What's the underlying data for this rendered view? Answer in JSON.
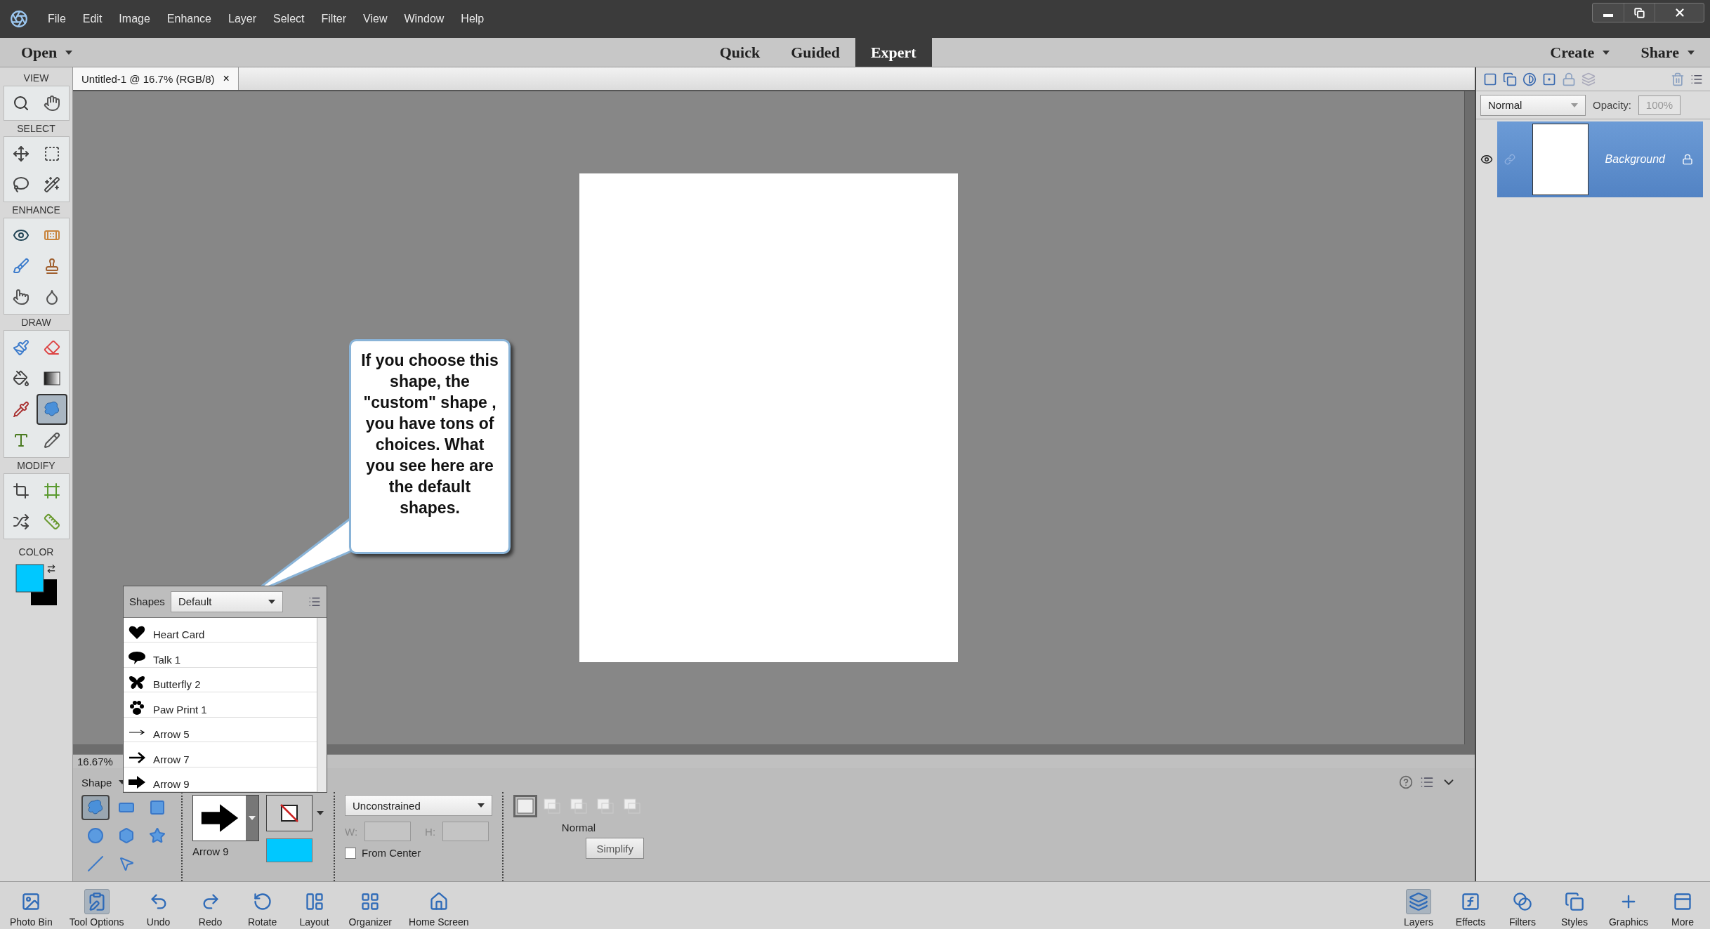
{
  "menu_bar": {
    "items": [
      "File",
      "Edit",
      "Image",
      "Enhance",
      "Layer",
      "Select",
      "Filter",
      "View",
      "Window",
      "Help"
    ]
  },
  "mode_bar": {
    "open": "Open",
    "modes": [
      {
        "label": "Quick",
        "selected": false
      },
      {
        "label": "Guided",
        "selected": false
      },
      {
        "label": "Expert",
        "selected": true
      }
    ],
    "create": "Create",
    "share": "Share"
  },
  "toolbox": {
    "groups": [
      {
        "label": "VIEW",
        "tools": [
          {
            "selected": false
          },
          {
            "selected": false
          }
        ]
      },
      {
        "label": "SELECT",
        "tools": [
          {
            "selected": false
          },
          {
            "selected": false
          },
          {
            "selected": false
          },
          {
            "selected": false
          }
        ]
      },
      {
        "label": "ENHANCE",
        "tools": [
          {
            "selected": false
          },
          {
            "selected": false
          },
          {
            "selected": false
          },
          {
            "selected": false
          },
          {
            "selected": false
          },
          {
            "selected": false
          }
        ]
      },
      {
        "label": "DRAW",
        "tools": [
          {
            "selected": false
          },
          {
            "selected": false
          },
          {
            "selected": false
          },
          {
            "selected": false
          },
          {
            "selected": false
          },
          {
            "selected": true
          },
          {
            "selected": false
          },
          {
            "selected": false
          }
        ]
      },
      {
        "label": "MODIFY",
        "tools": [
          {
            "selected": false
          },
          {
            "selected": false
          },
          {
            "selected": false
          },
          {
            "selected": false
          }
        ]
      }
    ],
    "color": {
      "label": "COLOR"
    }
  },
  "document_tab": {
    "title": "Untitled-1 @ 16.7% (RGB/8)",
    "close": "×"
  },
  "callout": "If you choose this shape, the \"custom\" shape , you have tons of choices.  What you see here are the default shapes.",
  "shapes_popup": {
    "label": "Shapes",
    "library": "Default",
    "items": [
      "Heart Card",
      "Talk 1",
      "Butterfly 2",
      "Paw Print 1",
      "Arrow 5",
      "Arrow 7",
      "Arrow 9"
    ]
  },
  "zoom_level": "16.67%",
  "tool_options": {
    "tool_label": "Shape",
    "shape_tools": [
      {
        "selected": true
      },
      {
        "selected": false
      },
      {
        "selected": false
      },
      {
        "selected": false
      },
      {
        "selected": false
      },
      {
        "selected": false
      },
      {
        "selected": false
      },
      {
        "selected": false
      }
    ],
    "shape_name": "Arrow 9",
    "constraint": "Unconstrained",
    "width_label": "W:",
    "height_label": "H:",
    "from_center": {
      "label": "From Center",
      "checked": false
    },
    "mode_label": "Normal",
    "simplify": "Simplify"
  },
  "layers_panel": {
    "blend_mode": "Normal",
    "opacity_label": "Opacity:",
    "opacity": "100%",
    "layers": [
      {
        "name": "Background",
        "selected": true,
        "visible": true
      }
    ]
  },
  "taskbar": {
    "left": [
      {
        "label": "Photo Bin",
        "selected": false
      },
      {
        "label": "Tool Options",
        "selected": true
      },
      {
        "label": "Undo",
        "selected": false
      },
      {
        "label": "Redo",
        "selected": false
      },
      {
        "label": "Rotate",
        "selected": false
      },
      {
        "label": "Layout",
        "selected": false
      },
      {
        "label": "Organizer",
        "selected": false
      },
      {
        "label": "Home Screen",
        "selected": false
      }
    ],
    "right": [
      {
        "label": "Layers",
        "selected": true
      },
      {
        "label": "Effects",
        "selected": false
      },
      {
        "label": "Filters",
        "selected": false
      },
      {
        "label": "Styles",
        "selected": false
      },
      {
        "label": "Graphics",
        "selected": false
      },
      {
        "label": "More",
        "selected": false
      }
    ]
  }
}
